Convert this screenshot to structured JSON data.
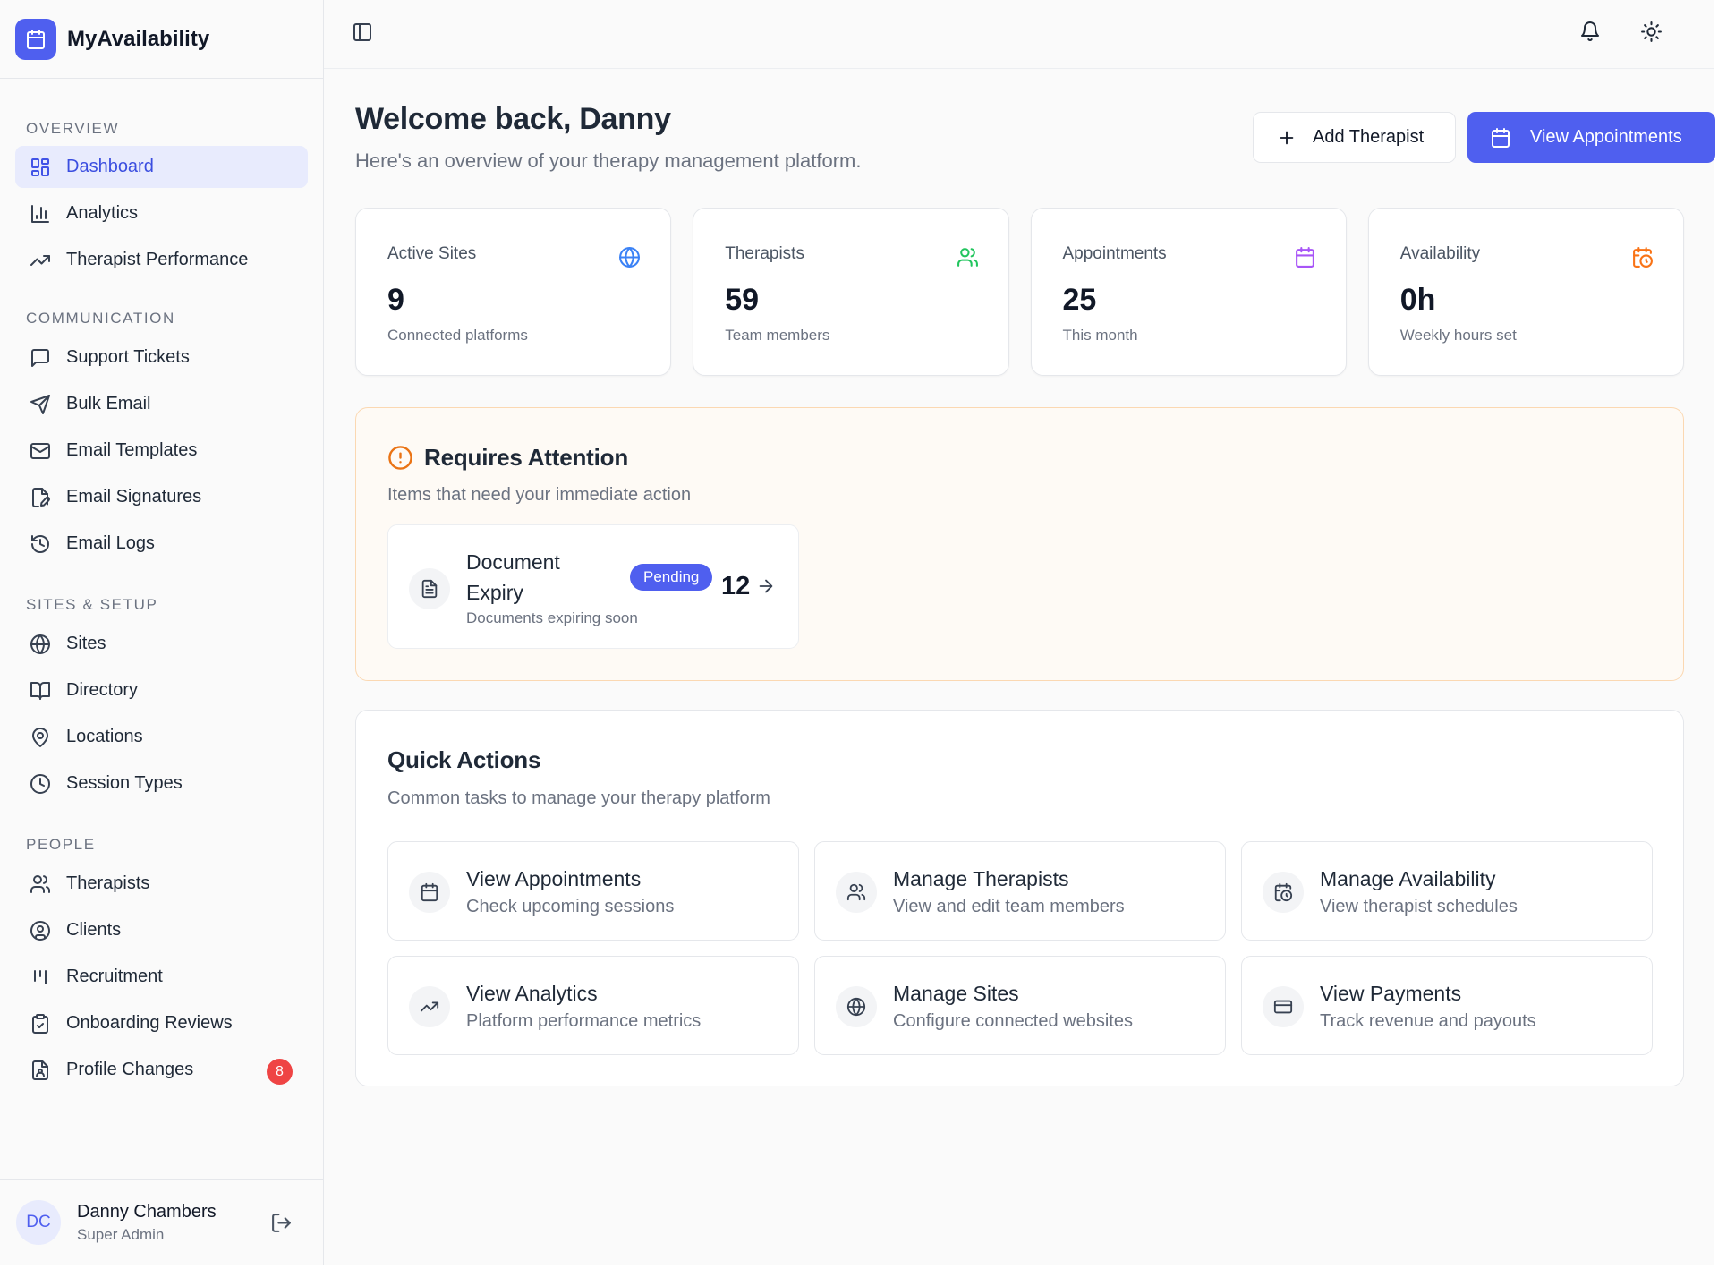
{
  "app": {
    "name": "MyAvailability"
  },
  "sidebar": {
    "sections": [
      {
        "title": "OVERVIEW",
        "items": [
          {
            "label": "Dashboard",
            "icon": "dashboard-icon",
            "active": true
          },
          {
            "label": "Analytics",
            "icon": "bar-chart-icon"
          },
          {
            "label": "Therapist Performance",
            "icon": "trending-up-icon"
          }
        ]
      },
      {
        "title": "COMMUNICATION",
        "items": [
          {
            "label": "Support Tickets",
            "icon": "message-square-icon"
          },
          {
            "label": "Bulk Email",
            "icon": "send-icon"
          },
          {
            "label": "Email Templates",
            "icon": "mail-icon"
          },
          {
            "label": "Email Signatures",
            "icon": "file-signature-icon"
          },
          {
            "label": "Email Logs",
            "icon": "history-icon"
          }
        ]
      },
      {
        "title": "SITES & SETUP",
        "items": [
          {
            "label": "Sites",
            "icon": "globe-icon"
          },
          {
            "label": "Directory",
            "icon": "book-open-icon"
          },
          {
            "label": "Locations",
            "icon": "map-pin-icon"
          },
          {
            "label": "Session Types",
            "icon": "clock-icon"
          }
        ]
      },
      {
        "title": "PEOPLE",
        "items": [
          {
            "label": "Therapists",
            "icon": "users-icon"
          },
          {
            "label": "Clients",
            "icon": "user-circle-icon"
          },
          {
            "label": "Recruitment",
            "icon": "kanban-icon"
          },
          {
            "label": "Onboarding Reviews",
            "icon": "clipboard-check-icon"
          },
          {
            "label": "Profile Changes",
            "icon": "file-user-icon",
            "badge": "8"
          }
        ]
      }
    ]
  },
  "user": {
    "initials": "DC",
    "name": "Danny Chambers",
    "role": "Super Admin"
  },
  "header": {
    "title": "Welcome back, Danny",
    "subtitle": "Here's an overview of your therapy management platform.",
    "add_label": "Add Therapist",
    "view_label": "View Appointments"
  },
  "stats": [
    {
      "label": "Active Sites",
      "value": "9",
      "desc": "Connected platforms",
      "icon": "globe-icon",
      "color": "#3b82f6"
    },
    {
      "label": "Therapists",
      "value": "59",
      "desc": "Team members",
      "icon": "users-icon",
      "color": "#22c55e"
    },
    {
      "label": "Appointments",
      "value": "25",
      "desc": "This month",
      "icon": "calendar-icon",
      "color": "#a855f7"
    },
    {
      "label": "Availability",
      "value": "0h",
      "desc": "Weekly hours set",
      "icon": "calendar-clock-icon",
      "color": "#f97316"
    }
  ],
  "attention": {
    "title": "Requires Attention",
    "subtitle": "Items that need your immediate action",
    "item": {
      "title": "Document Expiry",
      "desc": "Documents expiring soon",
      "badge": "Pending",
      "count": "12"
    }
  },
  "quick_actions": {
    "title": "Quick Actions",
    "subtitle": "Common tasks to manage your therapy platform",
    "items": [
      {
        "title": "View Appointments",
        "desc": "Check upcoming sessions",
        "icon": "calendar-icon"
      },
      {
        "title": "Manage Therapists",
        "desc": "View and edit team members",
        "icon": "users-icon"
      },
      {
        "title": "Manage Availability",
        "desc": "View therapist schedules",
        "icon": "calendar-clock-icon"
      },
      {
        "title": "View Analytics",
        "desc": "Platform performance metrics",
        "icon": "trending-up-icon"
      },
      {
        "title": "Manage Sites",
        "desc": "Configure connected websites",
        "icon": "globe-icon"
      },
      {
        "title": "View Payments",
        "desc": "Track revenue and payouts",
        "icon": "credit-card-icon"
      }
    ]
  },
  "colors": {
    "accent": "#4f5fef",
    "badge": "#ef4444",
    "warning": "#ea7314"
  }
}
